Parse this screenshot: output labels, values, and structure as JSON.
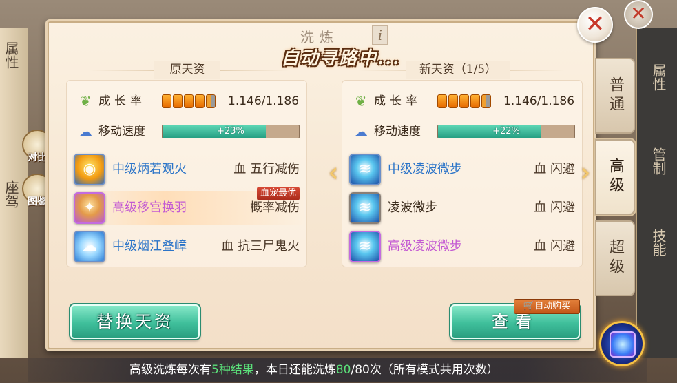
{
  "dialog": {
    "title": "洗炼",
    "info_icon": "i",
    "status_banner": "自动寻路中...",
    "close_label": "✕"
  },
  "original": {
    "header": "原天资",
    "growth_label": "成长率",
    "growth_value": "1.146/1.186",
    "growth_pips": 5,
    "speed_label": "移动速度",
    "speed_bar_text": "+23%",
    "speed_fill_fraction": 0.76,
    "skills": [
      {
        "name": "中级炳若观火",
        "effect": "血 五行减伤",
        "tier": "blue",
        "icon": "fire-eye-icon"
      },
      {
        "name": "高级移宫换羽",
        "effect": "概率减伤",
        "tier": "purple",
        "icon": "phoenix-feather-icon",
        "tag": "血宠最优"
      },
      {
        "name": "中级烟江叠嶂",
        "effect": "血 抗三尸鬼火",
        "tier": "blue",
        "icon": "cloud-mountain-icon"
      }
    ]
  },
  "new": {
    "header": "新天资（1/5）",
    "growth_label": "成长率",
    "growth_value": "1.146/1.186",
    "growth_pips": 5,
    "speed_label": "移动速度",
    "speed_bar_text": "+22%",
    "speed_fill_fraction": 0.75,
    "skills": [
      {
        "name": "中级凌波微步",
        "effect": "血 闪避",
        "tier": "blue",
        "icon": "wave-step-icon"
      },
      {
        "name": "凌波微步",
        "effect": "血 闪避",
        "tier": "dark",
        "icon": "wave-step-icon"
      },
      {
        "name": "高级凌波微步",
        "effect": "血 闪避",
        "tier": "purple",
        "icon": "wave-step-icon"
      }
    ]
  },
  "buttons": {
    "replace": "替换天资",
    "view": "查看",
    "auto_buy": "自动购买"
  },
  "side_tabs": [
    {
      "label": "普通",
      "active": false
    },
    {
      "label": "高级",
      "active": true
    },
    {
      "label": "超级",
      "active": false
    }
  ],
  "left_buttons": {
    "compare": "对比",
    "catalog": "图鉴"
  },
  "background_texts": {
    "left_attr": "属性",
    "left_seat": "座驾",
    "right_attr": "属性",
    "right_control": "管制",
    "right_skill": "技能"
  },
  "bottom_info": {
    "prefix": "高级洗炼每次有",
    "count_highlight": "5种结果",
    "middle": "，本日还能洗炼",
    "remaining_highlight": "80",
    "suffix": "/80次（所有模式共用次数）"
  },
  "colors": {
    "accent_teal": "#3fbf9b",
    "blue_skill": "#2b74c8",
    "purple_skill": "#c35ad3",
    "highlight_green": "#5be07a"
  }
}
